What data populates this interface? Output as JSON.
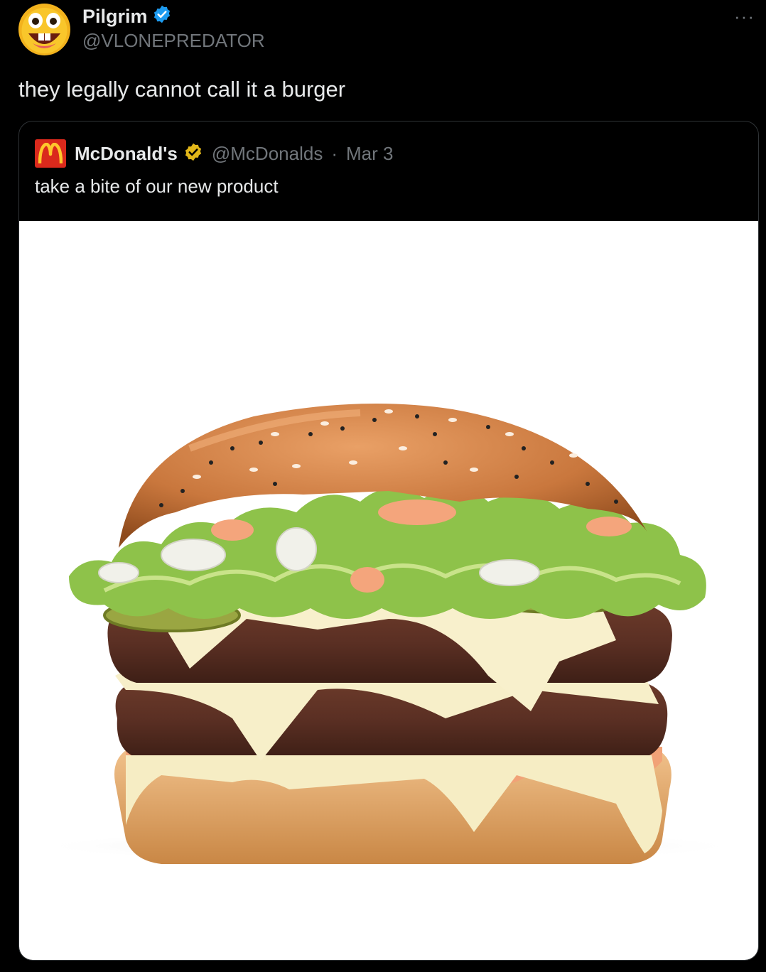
{
  "tweet": {
    "author_name": "Pilgrim",
    "author_handle": "@VLONEPREDATOR",
    "text": "they legally cannot call it a burger",
    "more_label": "···",
    "verified_color": "#1d9bf0"
  },
  "quote": {
    "author_name": "McDonald's",
    "author_handle": "@McDonalds",
    "separator": "·",
    "date": "Mar 3",
    "text": "take a bite of our new product",
    "verified_color": "#e2b719",
    "brand_color": "#da291c",
    "logo_icon": "mcdonalds-arches-icon"
  },
  "media": {
    "image_icon": "burger-photo"
  }
}
